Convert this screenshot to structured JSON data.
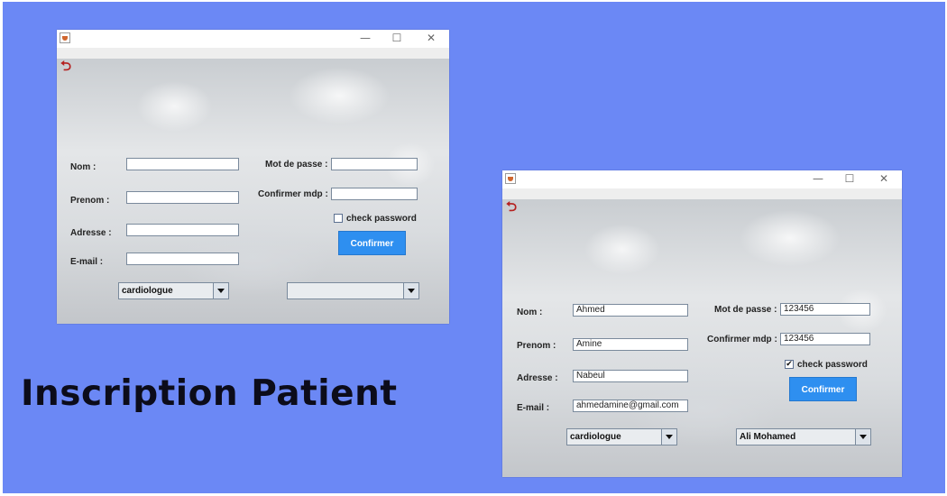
{
  "caption": "Inscription Patient",
  "colors": {
    "background": "#6b88f5",
    "button": "#2e8ff0",
    "back_icon": "#b5201f"
  },
  "window_controls": {
    "minimize": "—",
    "maximize": "☐",
    "close": "✕"
  },
  "icons": {
    "app": "java-app-icon",
    "back": "undo-arrow-icon"
  },
  "form_empty": {
    "labels": {
      "nom": "Nom :",
      "prenom": "Prenom :",
      "adresse": "Adresse :",
      "email": "E-mail :",
      "mdp": "Mot de passe :",
      "confirm_mdp": "Confirmer mdp :"
    },
    "values": {
      "nom": "",
      "prenom": "",
      "adresse": "",
      "email": "",
      "mdp": "",
      "confirm_mdp": ""
    },
    "check_password": {
      "label": "check password",
      "checked": false
    },
    "confirm_button": "Confirmer",
    "specialite": "cardiologue",
    "medecin": ""
  },
  "form_filled": {
    "labels": {
      "nom": "Nom :",
      "prenom": "Prenom :",
      "adresse": "Adresse :",
      "email": "E-mail :",
      "mdp": "Mot de passe :",
      "confirm_mdp": "Confirmer mdp :"
    },
    "values": {
      "nom": "Ahmed",
      "prenom": "Amine",
      "adresse": "Nabeul",
      "email": "ahmedamine@gmail.com",
      "mdp": "123456",
      "confirm_mdp": "123456"
    },
    "check_password": {
      "label": "check password",
      "checked": true,
      "mark": "✔"
    },
    "confirm_button": "Confirmer",
    "specialite": "cardiologue",
    "medecin": "Ali Mohamed"
  }
}
